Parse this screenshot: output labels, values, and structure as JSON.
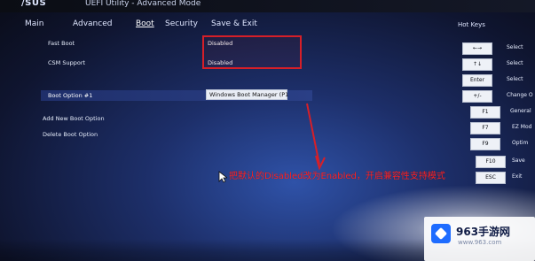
{
  "header": {
    "logo": "/SUS",
    "title": "UEFI Utility - Advanced Mode"
  },
  "tabs": [
    {
      "label": "Main"
    },
    {
      "label": "Advanced"
    },
    {
      "label": "Boot"
    },
    {
      "label": "Security"
    },
    {
      "label": "Save & Exit"
    }
  ],
  "settings": {
    "fast_boot": {
      "label": "Fast Boot",
      "value": "Disabled"
    },
    "csm_support": {
      "label": "CSM Support",
      "value": "Disabled"
    },
    "boot_option_1": {
      "label": "Boot Option #1",
      "value": "Windows Boot Manager (P1"
    },
    "add_new_boot_option": {
      "label": "Add New Boot Option"
    },
    "delete_boot_option": {
      "label": "Delete Boot Option"
    }
  },
  "hotkeys": {
    "title": "Hot Keys",
    "items": [
      {
        "key": "←→",
        "desc": "Select"
      },
      {
        "key": "↑↓",
        "desc": "Select"
      },
      {
        "key": "Enter",
        "desc": "Select"
      },
      {
        "key": "+/-",
        "desc": "Change O"
      },
      {
        "key": "F1",
        "desc": "General"
      },
      {
        "key": "F7",
        "desc": "EZ Mod"
      },
      {
        "key": "F9",
        "desc": "Optim"
      },
      {
        "key": "F10",
        "desc": "Save"
      },
      {
        "key": "ESC",
        "desc": "Exit"
      }
    ]
  },
  "annotation": {
    "text": "把默认的Disabled改为Enabled，开启兼容性支持模式"
  },
  "watermark": {
    "title": "963手游网",
    "url": "www.963.com"
  },
  "colors": {
    "annotation_red": "#d61f28",
    "bios_blue": "#1d2f6a"
  }
}
